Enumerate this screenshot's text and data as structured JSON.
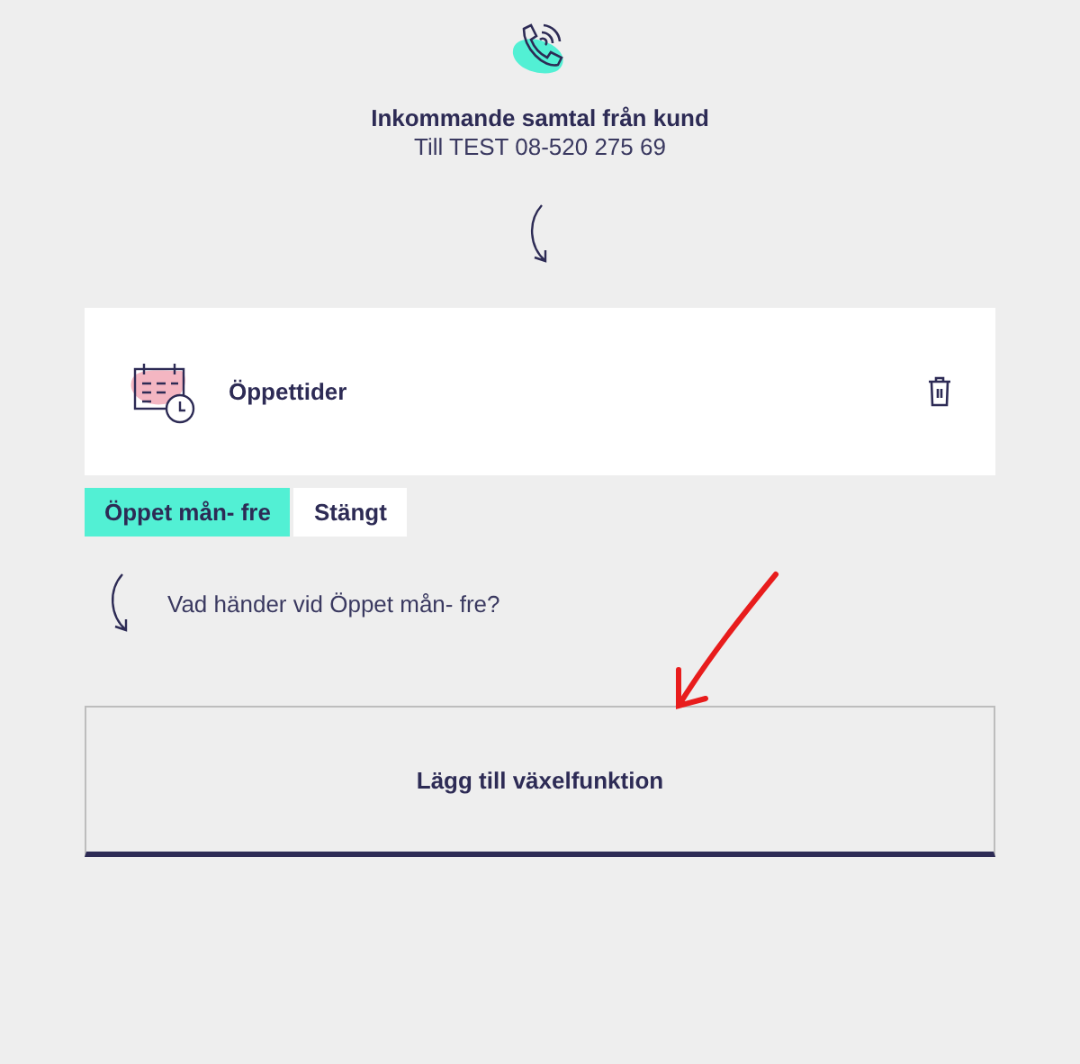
{
  "header": {
    "title": "Inkommande samtal från kund",
    "subtitle": "Till TEST 08-520 275 69"
  },
  "card": {
    "title": "Öppettider"
  },
  "tabs": [
    {
      "label": "Öppet mån- fre",
      "selected": true
    },
    {
      "label": "Stängt",
      "selected": false
    }
  ],
  "question": "Vad händer vid Öppet mån- fre?",
  "add_button": "Lägg till växelfunktion"
}
